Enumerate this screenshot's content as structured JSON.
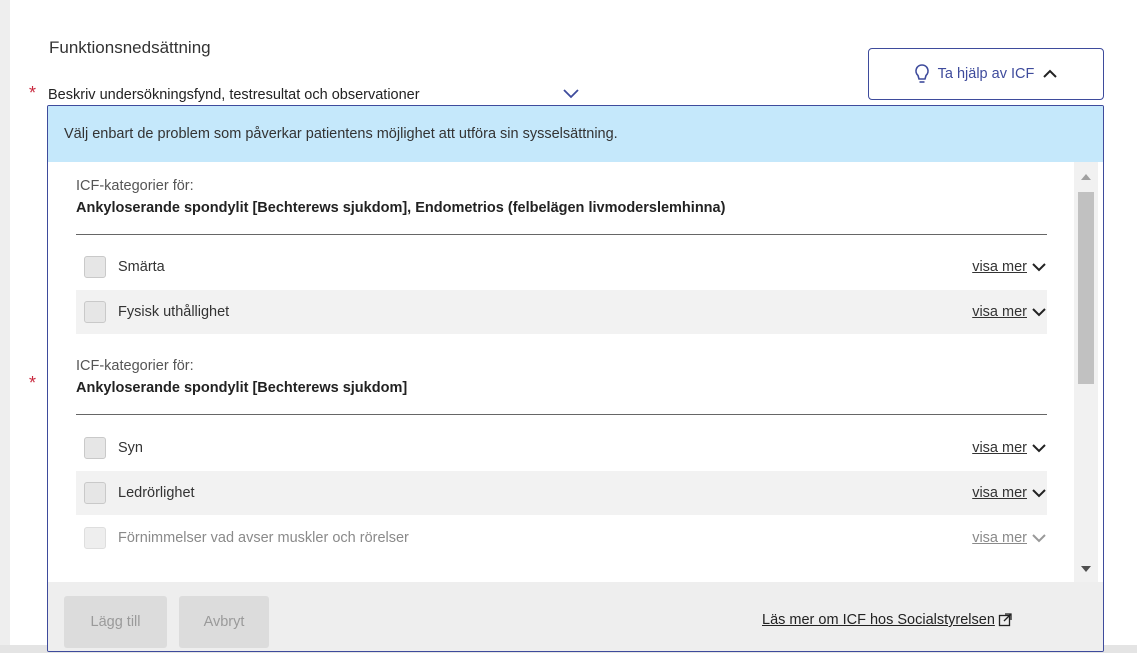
{
  "section": {
    "title": "Funktionsnedsättning",
    "required_mark": "*",
    "question_label": "Beskriv undersökningsfynd, testresultat och observationer"
  },
  "icf_button": {
    "label": "Ta hjälp av ICF",
    "icon": "lightbulb-icon"
  },
  "popup": {
    "info": "Välj enbart de problem som påverkar patientens möjlighet att utföra sin sysselsättning.",
    "groups": [
      {
        "subtitle": "ICF-kategorier för:",
        "diagnoses": "Ankyloserande spondylit [Bechterews sjukdom], Endometrios (felbelägen livmoderslemhinna)",
        "categories": [
          {
            "label": "Smärta",
            "more": "visa mer"
          },
          {
            "label": "Fysisk uthållighet",
            "more": "visa mer"
          }
        ]
      },
      {
        "subtitle": "ICF-kategorier för:",
        "diagnoses": "Ankyloserande spondylit [Bechterews sjukdom]",
        "categories": [
          {
            "label": "Syn",
            "more": "visa mer"
          },
          {
            "label": "Ledrörlighet",
            "more": "visa mer"
          },
          {
            "label": "Förnimmelser vad avser muskler och rörelser",
            "more": "visa mer"
          }
        ]
      }
    ],
    "footer": {
      "add_label": "Lägg till",
      "cancel_label": "Avbryt",
      "link_label": "Läs mer om ICF hos Socialstyrelsen"
    }
  },
  "colors": {
    "accent": "#3e4b9c",
    "required": "#c9283e",
    "info_bg": "#c5e8fb"
  }
}
